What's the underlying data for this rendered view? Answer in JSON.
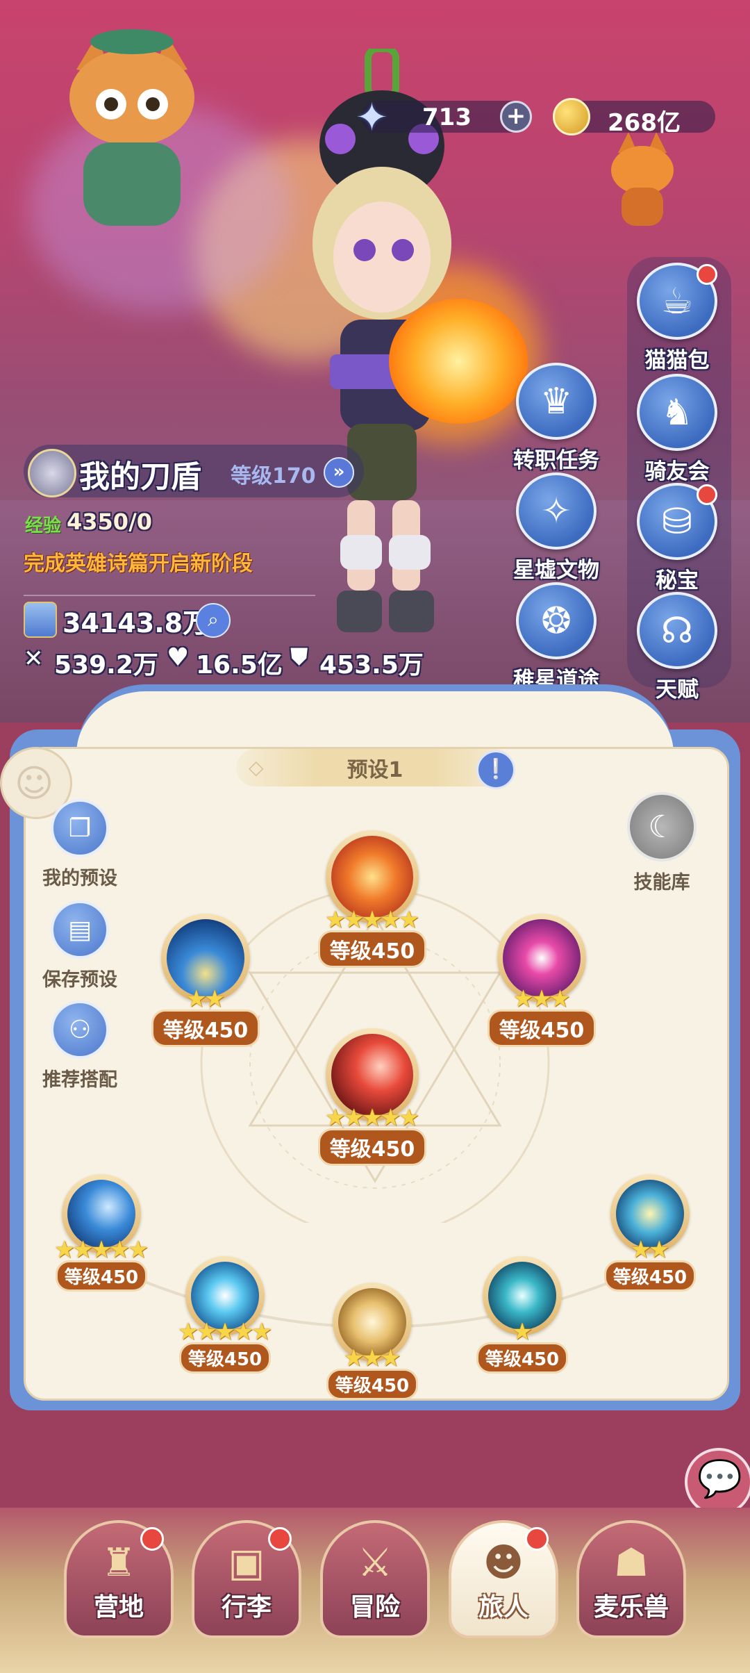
{
  "currency": {
    "stars": "713",
    "coins": "268亿"
  },
  "side_menu": {
    "right_col": [
      "猫猫包",
      "骑友会",
      "秘宝",
      "天赋"
    ],
    "left_col": [
      "转职任务",
      "星墟文物",
      "稚星道途"
    ]
  },
  "character": {
    "name": "我的刀盾",
    "level": "等级170",
    "exp_label": "经验",
    "exp_value": "4350/0",
    "hint": "完成英雄诗篇开启新阶段",
    "power": "34143.8万",
    "attack": "539.2万",
    "hp": "16.5亿",
    "defense": "453.5万"
  },
  "panel": {
    "preset_title": "预设1",
    "left_buttons": [
      "我的预设",
      "保存预设",
      "推荐搭配"
    ],
    "skill_library": "技能库"
  },
  "skills": {
    "top": {
      "level": "等级450",
      "stars": 5
    },
    "left": {
      "level": "等级450",
      "stars": 2
    },
    "right": {
      "level": "等级450",
      "stars": 3
    },
    "center": {
      "level": "等级450",
      "stars": 5
    },
    "bottom": [
      {
        "level": "等级450",
        "stars": 5
      },
      {
        "level": "等级450",
        "stars": 5
      },
      {
        "level": "等级450",
        "stars": 3
      },
      {
        "level": "等级450",
        "stars": 1
      },
      {
        "level": "等级450",
        "stars": 2
      }
    ]
  },
  "nav": {
    "items": [
      "营地",
      "行李",
      "冒险",
      "旅人",
      "麦乐兽"
    ],
    "active": "旅人"
  },
  "colors": {
    "scene_top": "#c8436e",
    "panel_blue": "#6c93d8",
    "panel_cream": "#f8f2e4",
    "level_badge": "#b0571e",
    "star": "#f7d64a",
    "badge_red": "#e8473f"
  }
}
